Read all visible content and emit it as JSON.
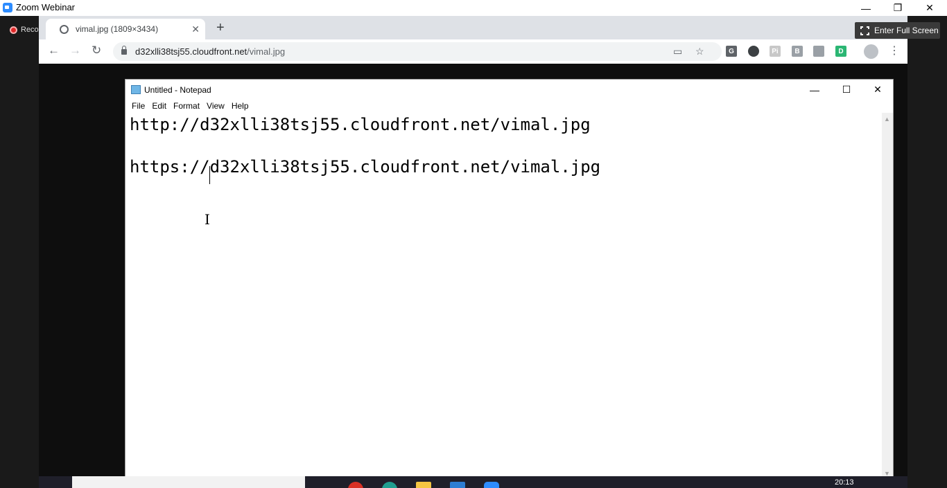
{
  "zoom": {
    "title": "Zoom Webinar",
    "recording_label": "Reco",
    "fullscreen_label": "Enter Full Screen",
    "controls": {
      "minimize": "—",
      "restore": "❐",
      "close": "✕"
    }
  },
  "browser": {
    "tab_title": "vimal.jpg (1809×3434)",
    "tab_close": "✕",
    "new_tab": "+",
    "url_host": "d32xlli38tsj55.cloudfront.net",
    "url_path": "/vimal.jpg",
    "back": "←",
    "forward": "→",
    "reload": "↻",
    "extensions": [
      {
        "name": "G",
        "color": "#5f6368"
      },
      {
        "name": "",
        "color": "#3c4043"
      },
      {
        "name": "Pi",
        "color": "#c8c8c8"
      },
      {
        "name": "B",
        "color": "#9aa0a6"
      },
      {
        "name": "",
        "color": "#9aa0a6"
      },
      {
        "name": "D",
        "color": "#2bb673"
      }
    ]
  },
  "notepad": {
    "title": "Untitled - Notepad",
    "menu": [
      "File",
      "Edit",
      "Format",
      "View",
      "Help"
    ],
    "lines": [
      "http://d32xlli38tsj55.cloudfront.net/vimal.jpg",
      "https://d32xlli38tsj55.cloudfront.net/vimal.jpg"
    ],
    "controls": {
      "minimize": "—",
      "maximize": "☐",
      "close": "✕"
    }
  },
  "taskbar": {
    "clock": "20:13"
  }
}
